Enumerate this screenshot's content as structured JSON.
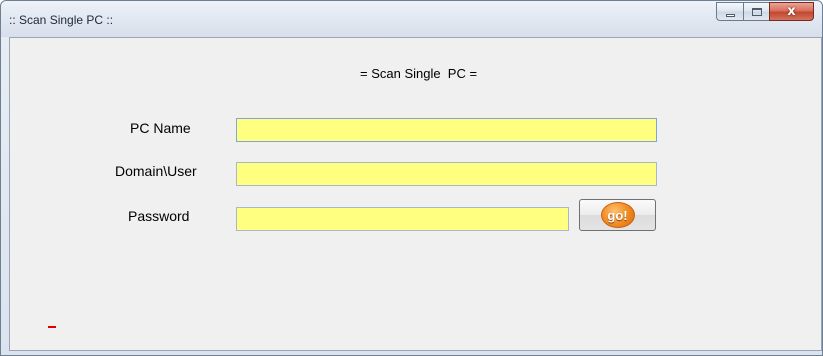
{
  "window": {
    "title": ":: Scan Single PC ::",
    "minimize_icon": "minimize-icon",
    "maximize_icon": "maximize-icon",
    "close_icon": "close-icon",
    "close_glyph": "x"
  },
  "form": {
    "header": "= Scan Single  PC =",
    "pc_name_label": "PC Name",
    "pc_name_value": "",
    "domain_user_label": "Domain\\User",
    "domain_user_value": "",
    "password_label": "Password",
    "password_value": "",
    "go_button_label": "go!"
  },
  "status": {
    "indicator_color": "#e00000"
  },
  "colors": {
    "input_background": "#ffff80",
    "go_badge": "#f08a20"
  }
}
